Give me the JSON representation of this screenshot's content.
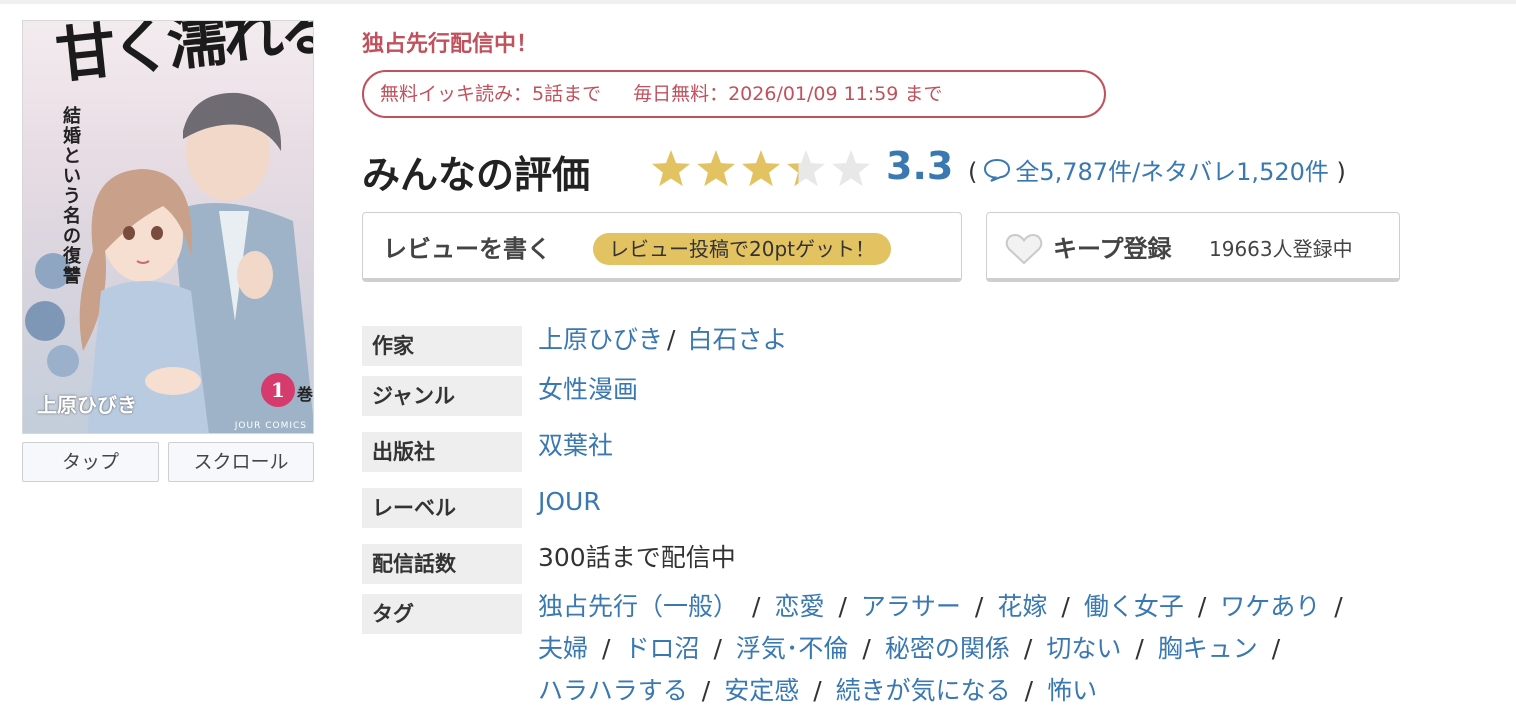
{
  "cover": {
    "title": "甘く濡れる嘘",
    "subtitle": "結婚という名の復讐",
    "volume_number": "1",
    "volume_suffix": "巻",
    "author": "上原ひびき",
    "publisher_mark": "JOUR COMICS"
  },
  "view_buttons": {
    "tap": "タップ",
    "scroll": "スクロール"
  },
  "exclusive_label": "独占先行配信中！",
  "free_info": {
    "binge": "無料イッキ読み：5話まで",
    "daily": "毎日無料：2026/01/09 11:59 まで"
  },
  "rating": {
    "label": "みんなの評価",
    "score": "3.3",
    "score_value": 3.3,
    "max_stars": 5,
    "paren_open": "(",
    "paren_close": ")",
    "count_text": "全5,787件/ネタバレ1,520件",
    "star_color": "#e3c261",
    "star_empty_color": "#e8e8e8"
  },
  "review_button": {
    "label": "レビューを書く",
    "pill": "レビュー投稿で20ptゲット！"
  },
  "keep_button": {
    "icon": "heart-icon",
    "label": "キープ登録",
    "count": "19663人登録中"
  },
  "details": {
    "author": {
      "label": "作家",
      "values": [
        "上原ひびき",
        "白石さよ"
      ],
      "separator": "/"
    },
    "genre": {
      "label": "ジャンル",
      "value": "女性漫画"
    },
    "publisher": {
      "label": "出版社",
      "value": "双葉社"
    },
    "imprint": {
      "label": "レーベル",
      "value": "JOUR"
    },
    "episodes": {
      "label": "配信話数",
      "value": "300話まで配信中"
    },
    "tags": {
      "label": "タグ",
      "separator": "/",
      "lines": [
        [
          "独占先行（一般）",
          "恋愛",
          "アラサー",
          "花嫁",
          "働く女子",
          "ワケあり"
        ],
        [
          "夫婦",
          "ドロ沼",
          "浮気･不倫",
          "秘密の関係",
          "切ない",
          "胸キュン"
        ],
        [
          "ハラハラする",
          "安定感",
          "続きが気になる",
          "怖い"
        ]
      ]
    }
  },
  "colors": {
    "accent_red": "#c1515c",
    "link_blue": "#3a78b2",
    "label_bg": "#eeeeee"
  }
}
